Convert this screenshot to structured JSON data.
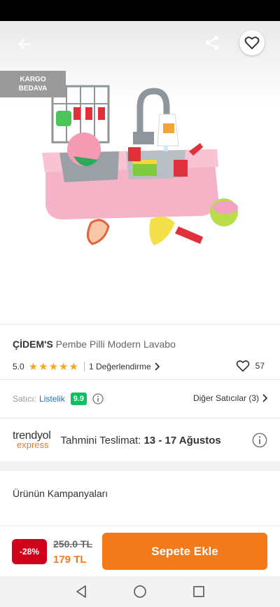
{
  "badge": {
    "cargo_line1": "KARGO",
    "cargo_line2": "BEDAVA"
  },
  "icons": {
    "back": "arrow-left-icon",
    "share": "share-icon",
    "favorite": "heart-outline-icon",
    "info": "info-circle-icon",
    "chevron": "chevron-right-icon",
    "star": "star-icon"
  },
  "product": {
    "brand": "ÇİDEM'S",
    "name": "Pembe Pilli Modern Lavabo",
    "rating": "5.0",
    "stars": 5,
    "reviews": "1 Değerlendirme",
    "likes": "57"
  },
  "seller": {
    "label": "Satıcı:",
    "name": "Listelik",
    "score": "9.9",
    "others": "Diğer Satıcılar (3)"
  },
  "delivery": {
    "logo_main": "trendyol",
    "logo_sub": "express",
    "label": "Tahmini Teslimat:",
    "dates": "13 - 17 Ağustos"
  },
  "campaigns": {
    "title": "Ürünün Kampanyaları"
  },
  "purchase": {
    "discount": "-28%",
    "old_price": "250.0 TL",
    "new_price": "179 TL",
    "add_to_cart": "Sepete Ekle"
  },
  "colors": {
    "accent_orange": "#f27a1a",
    "discount_red": "#d0021b",
    "seller_green": "#0bc15c",
    "star_gold": "#f6a623",
    "link_blue": "#2a6fb4"
  }
}
